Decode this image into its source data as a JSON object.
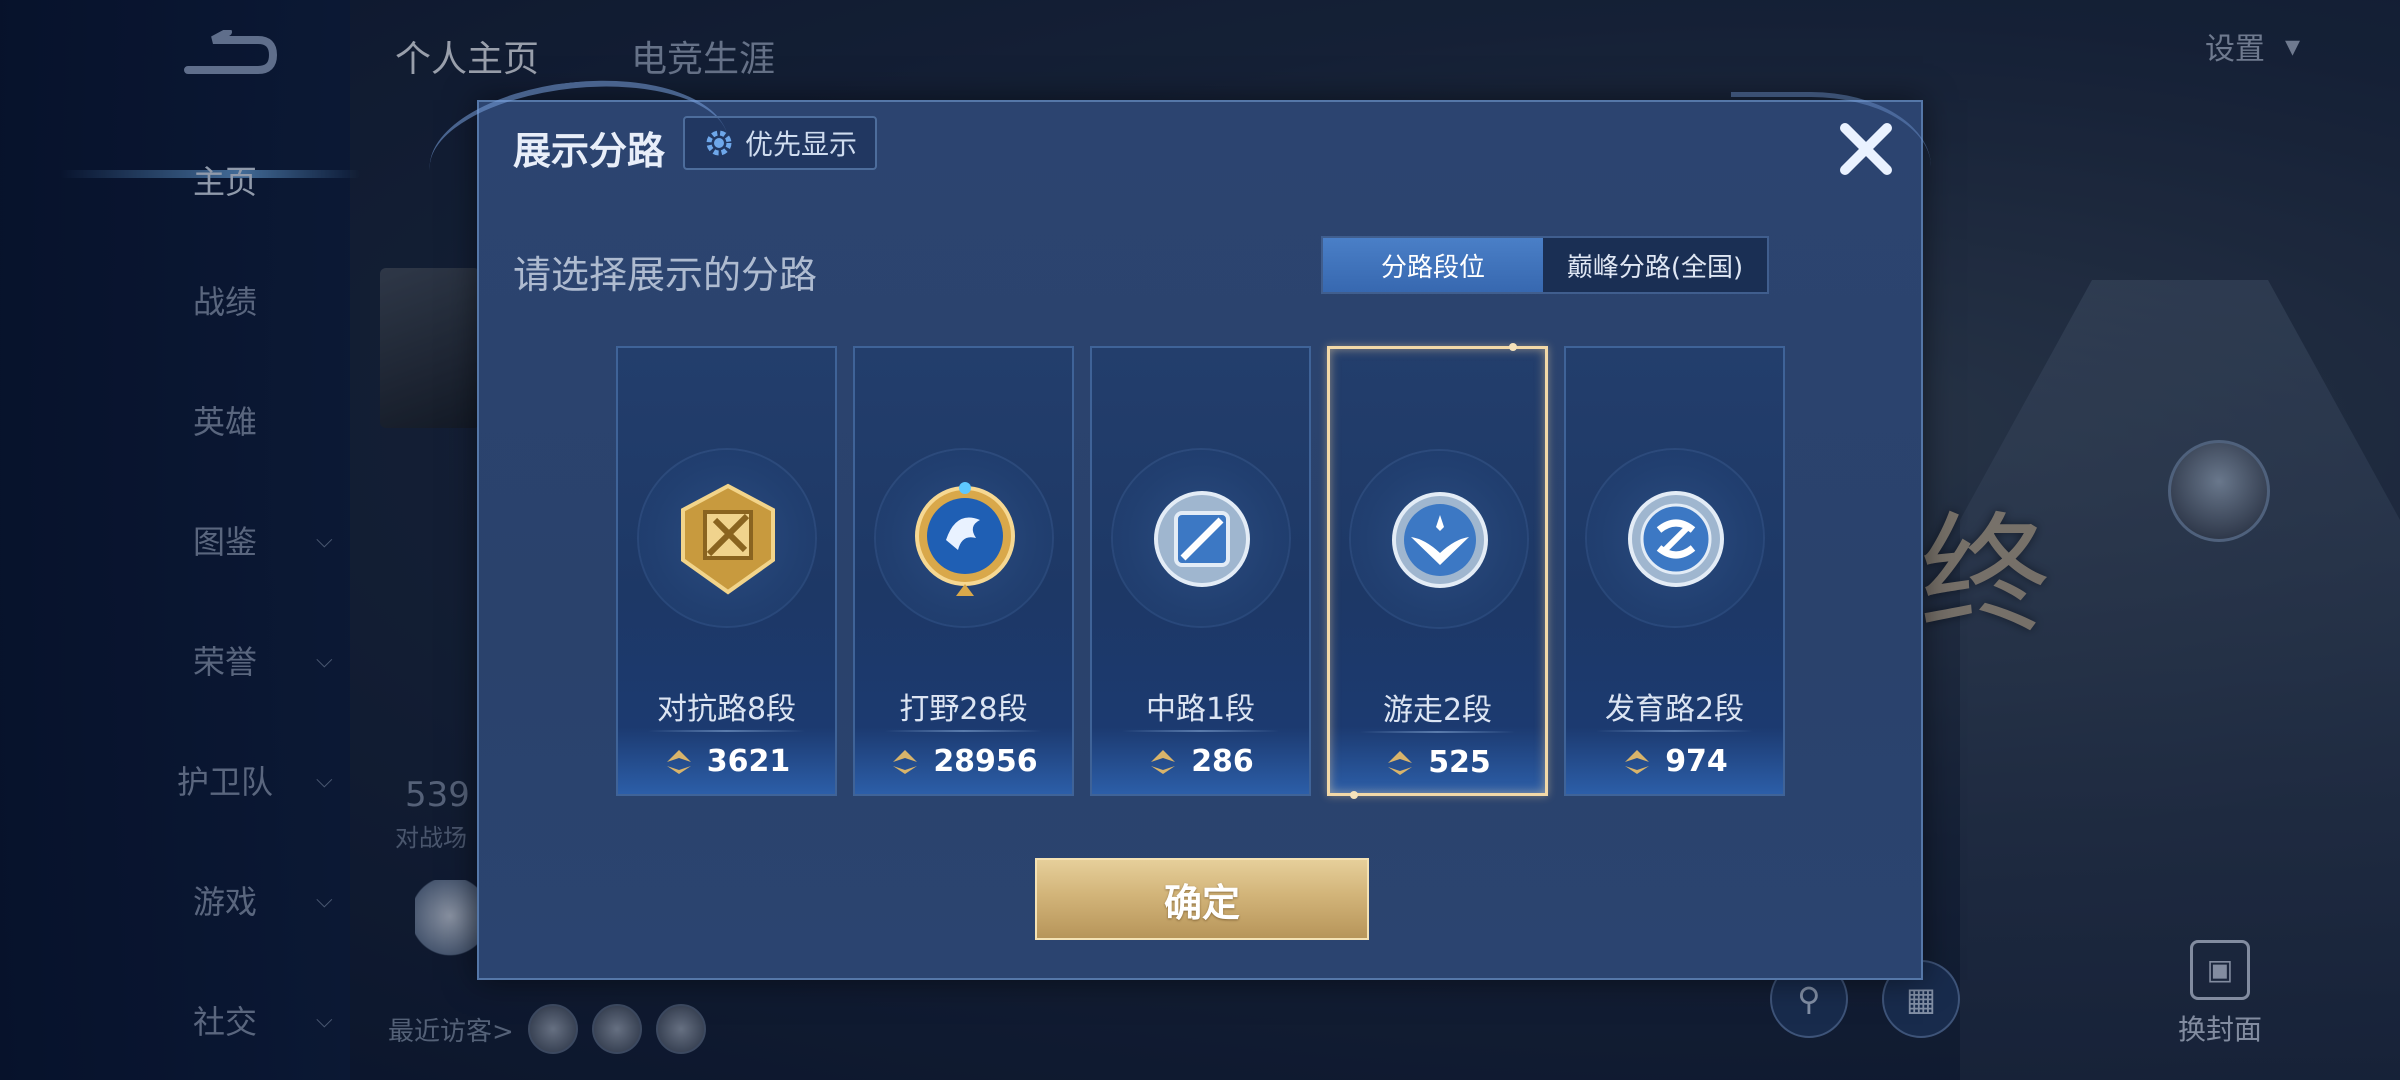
{
  "background": {
    "sidebar": {
      "items": [
        {
          "label": "主页",
          "has_chevron": false,
          "active": true
        },
        {
          "label": "战绩",
          "has_chevron": false
        },
        {
          "label": "英雄",
          "has_chevron": false
        },
        {
          "label": "图鉴",
          "has_chevron": true
        },
        {
          "label": "荣誉",
          "has_chevron": true
        },
        {
          "label": "护卫队",
          "has_chevron": true
        },
        {
          "label": "游戏",
          "has_chevron": true
        },
        {
          "label": "社交",
          "has_chevron": true
        }
      ]
    },
    "top_tabs": [
      {
        "label": "个人主页",
        "active": true
      },
      {
        "label": "电竞生涯",
        "active": false
      }
    ],
    "settings_label": "设置",
    "stats_number": "539",
    "stats_label": "对战场",
    "recent_visitors_label": "最近访客>",
    "scene_text": "终",
    "change_cover_label": "换封面"
  },
  "modal": {
    "title": "展示分路",
    "priority_label": "优先显示",
    "prompt": "请选择展示的分路",
    "toggle": {
      "active": "分路段位",
      "inactive": "巅峰分路(全国)"
    },
    "lanes": [
      {
        "name": "对抗路8段",
        "score": "3621",
        "emblem": "clash-lane-emblem-icon",
        "color": "#d8b25a",
        "selected": false
      },
      {
        "name": "打野28段",
        "score": "28956",
        "emblem": "jungle-emblem-icon",
        "color": "#2b7fd6",
        "selected": false
      },
      {
        "name": "中路1段",
        "score": "286",
        "emblem": "mid-lane-emblem-icon",
        "color": "#6a9ad0",
        "selected": false
      },
      {
        "name": "游走2段",
        "score": "525",
        "emblem": "roam-emblem-icon",
        "color": "#6a9ad0",
        "selected": true
      },
      {
        "name": "发育路2段",
        "score": "974",
        "emblem": "farm-lane-emblem-icon",
        "color": "#6a9ad0",
        "selected": false
      }
    ],
    "confirm_label": "确定"
  },
  "colors": {
    "modal_bg": "#2c4470",
    "accent_blue": "#3768b0",
    "gold": "#d2b479",
    "selected_border": "#f3d9a8"
  }
}
